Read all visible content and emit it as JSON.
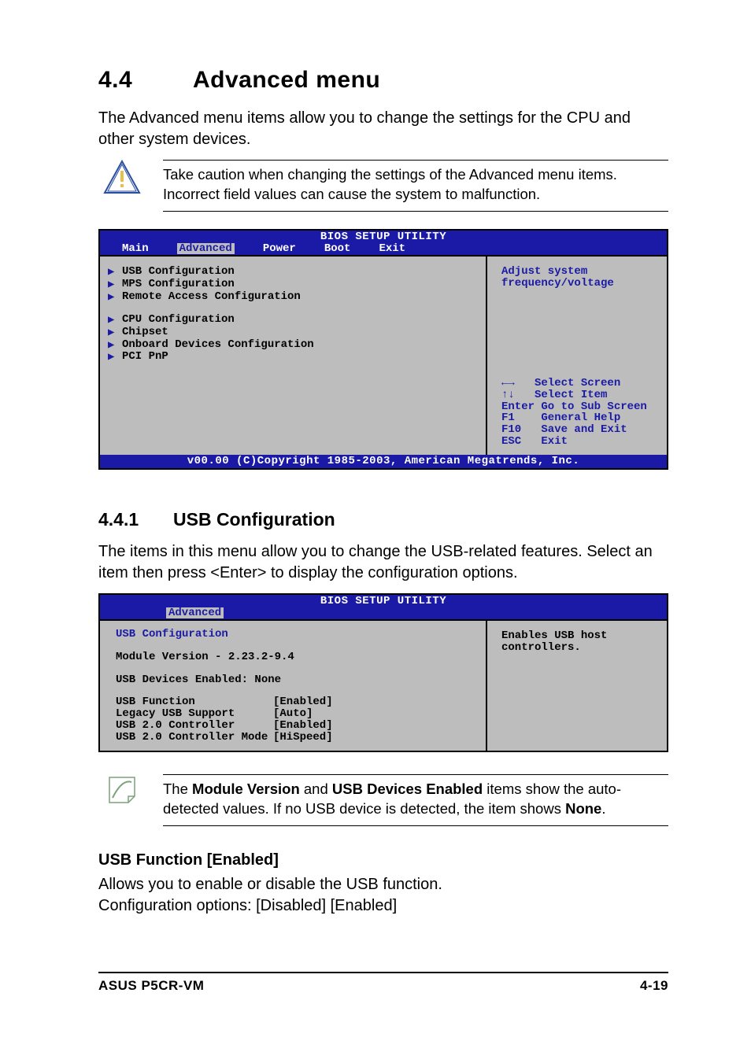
{
  "header": {
    "section_number": "4.4",
    "section_title": "Advanced menu",
    "intro": "The Advanced menu items allow you to change the settings for the CPU and other system devices."
  },
  "caution": {
    "text": "Take caution when changing the settings of the Advanced menu items. Incorrect field values can cause the system to malfunction."
  },
  "bios1": {
    "title": "BIOS SETUP UTILITY",
    "tabs": {
      "main": "Main",
      "advanced": "Advanced",
      "power": "Power",
      "boot": "Boot",
      "exit": "Exit"
    },
    "group1": [
      "USB Configuration",
      "MPS Configuration",
      "Remote Access Configuration"
    ],
    "group2": [
      "CPU Configuration",
      "Chipset",
      "Onboard Devices Configuration",
      "PCI PnP"
    ],
    "help_top": "Adjust system\nfrequency/voltage",
    "keys": {
      "lr": "←→   Select Screen",
      "ud": "↑↓   Select Item",
      "enter": "Enter Go to Sub Screen",
      "f1": "F1    General Help",
      "f10": "F10   Save and Exit",
      "esc": "ESC   Exit"
    },
    "footer": "v00.00 (C)Copyright 1985-2003, American Megatrends, Inc."
  },
  "sub441": {
    "number": "4.4.1",
    "title": "USB Configuration",
    "intro": "The items in this menu allow you to change the USB-related features. Select an item then press <Enter> to display the configuration options."
  },
  "bios2": {
    "title": "BIOS SETUP UTILITY",
    "tab": "Advanced",
    "heading": "USB Configuration",
    "module": "Module Version - 2.23.2-9.4",
    "devices": "USB Devices Enabled: None",
    "settings": [
      {
        "label": "USB Function",
        "value": "[Enabled]"
      },
      {
        "label": "Legacy USB Support",
        "value": "[Auto]"
      },
      {
        "label": "USB 2.0 Controller",
        "value": "[Enabled]"
      },
      {
        "label": "USB 2.0 Controller Mode",
        "value": "[HiSpeed]"
      }
    ],
    "help": "Enables USB host\ncontrollers."
  },
  "note": {
    "pre": "The ",
    "b1": "Module Version",
    "mid1": " and ",
    "b2": "USB Devices Enabled",
    "mid2": " items show the auto-detected values. If no USB device is detected, the item shows ",
    "b3": "None",
    "post": "."
  },
  "usbfunc": {
    "heading": "USB Function [Enabled]",
    "line1": "Allows you to enable or disable the USB function.",
    "line2": "Configuration options: [Disabled] [Enabled]"
  },
  "footer": {
    "left": "ASUS P5CR-VM",
    "right": "4-19"
  }
}
